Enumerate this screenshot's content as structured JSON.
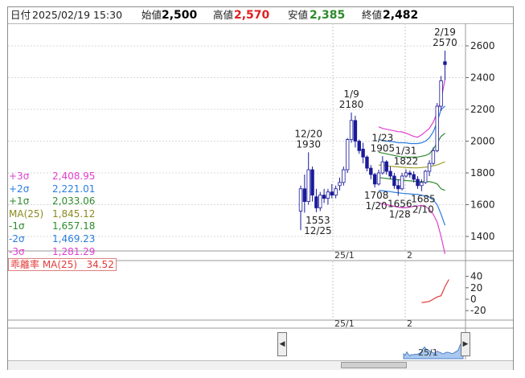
{
  "header": {
    "date_label": "日付",
    "datetime": "2025/02/19 15:30",
    "open_label": "始値",
    "open": "2,500",
    "high_label": "高値",
    "high": "2,570",
    "low_label": "安値",
    "low": "2,385",
    "close_label": "終値",
    "close": "2,482"
  },
  "legend": [
    {
      "name": "+3σ",
      "value": "2,408.95",
      "color": "#e040d0"
    },
    {
      "name": "+2σ",
      "value": "2,221.01",
      "color": "#2a7de0"
    },
    {
      "name": "+1σ",
      "value": "2,033.06",
      "color": "#2e8b2e"
    },
    {
      "name": "MA(25)",
      "value": "1,845.12",
      "color": "#8a8a20"
    },
    {
      "name": "-1σ",
      "value": "1,657.18",
      "color": "#2e8b2e"
    },
    {
      "name": "-2σ",
      "value": "1,469.23",
      "color": "#2a7de0"
    },
    {
      "name": "-3σ",
      "value": "1,281.29",
      "color": "#e040d0"
    }
  ],
  "oscillator": {
    "label": "乖離率 MA(25)",
    "value": "34.52",
    "color": "#e23a3a"
  },
  "x_tick_labels": [
    "25/1",
    "2"
  ],
  "navigator_tick_label": "25/1",
  "scroll_left_icon": "◀",
  "scroll_right_icon": "▶",
  "annotations": [
    {
      "date": "12/20",
      "value": "1930"
    },
    {
      "date": "1/9",
      "value": "2180"
    },
    {
      "date": "1/23",
      "value": "1905"
    },
    {
      "date": "1/31",
      "value": "1822"
    },
    {
      "date": "2/19",
      "value": "2570"
    },
    {
      "date": "12/25",
      "value": "1553"
    },
    {
      "date": "1/20",
      "value": "1708"
    },
    {
      "date": "1/28",
      "value": "1656"
    },
    {
      "date": "2/10",
      "value": "1685"
    }
  ],
  "chart_data": [
    {
      "type": "candlestick",
      "title": "",
      "y_ticks": [
        1400,
        1600,
        1800,
        2000,
        2200,
        2400,
        2600
      ],
      "ylim": [
        1290,
        2700
      ],
      "x_tick_labels": [
        "25/1",
        "2"
      ],
      "candles": [
        {
          "o": 1560,
          "h": 1720,
          "l": 1440,
          "c": 1700
        },
        {
          "o": 1700,
          "h": 1790,
          "l": 1550,
          "c": 1620
        },
        {
          "o": 1620,
          "h": 1930,
          "l": 1600,
          "c": 1820
        },
        {
          "o": 1820,
          "h": 1840,
          "l": 1620,
          "c": 1660
        },
        {
          "o": 1650,
          "h": 1700,
          "l": 1553,
          "c": 1580
        },
        {
          "o": 1580,
          "h": 1680,
          "l": 1560,
          "c": 1660
        },
        {
          "o": 1660,
          "h": 1700,
          "l": 1610,
          "c": 1640
        },
        {
          "o": 1640,
          "h": 1700,
          "l": 1600,
          "c": 1680
        },
        {
          "o": 1680,
          "h": 1730,
          "l": 1640,
          "c": 1660
        },
        {
          "o": 1660,
          "h": 1720,
          "l": 1640,
          "c": 1700
        },
        {
          "o": 1720,
          "h": 1770,
          "l": 1690,
          "c": 1740
        },
        {
          "o": 1740,
          "h": 1840,
          "l": 1720,
          "c": 1820
        },
        {
          "o": 1820,
          "h": 2020,
          "l": 1800,
          "c": 2010
        },
        {
          "o": 2010,
          "h": 2180,
          "l": 1990,
          "c": 2130
        },
        {
          "o": 2130,
          "h": 2160,
          "l": 1960,
          "c": 2000
        },
        {
          "o": 2000,
          "h": 2010,
          "l": 1920,
          "c": 1940
        },
        {
          "o": 1950,
          "h": 1990,
          "l": 1860,
          "c": 1900
        },
        {
          "o": 1900,
          "h": 1910,
          "l": 1810,
          "c": 1830
        },
        {
          "o": 1830,
          "h": 1850,
          "l": 1760,
          "c": 1790
        },
        {
          "o": 1790,
          "h": 1800,
          "l": 1708,
          "c": 1730
        },
        {
          "o": 1730,
          "h": 1820,
          "l": 1720,
          "c": 1800
        },
        {
          "o": 1800,
          "h": 1905,
          "l": 1790,
          "c": 1870
        },
        {
          "o": 1870,
          "h": 1880,
          "l": 1790,
          "c": 1810
        },
        {
          "o": 1810,
          "h": 1840,
          "l": 1760,
          "c": 1780
        },
        {
          "o": 1780,
          "h": 1800,
          "l": 1700,
          "c": 1720
        },
        {
          "o": 1720,
          "h": 1760,
          "l": 1656,
          "c": 1700
        },
        {
          "o": 1700,
          "h": 1800,
          "l": 1690,
          "c": 1780
        },
        {
          "o": 1780,
          "h": 1822,
          "l": 1770,
          "c": 1800
        },
        {
          "o": 1800,
          "h": 1815,
          "l": 1770,
          "c": 1790
        },
        {
          "o": 1790,
          "h": 1810,
          "l": 1740,
          "c": 1760
        },
        {
          "o": 1760,
          "h": 1780,
          "l": 1700,
          "c": 1720
        },
        {
          "o": 1720,
          "h": 1760,
          "l": 1685,
          "c": 1740
        },
        {
          "o": 1740,
          "h": 1820,
          "l": 1730,
          "c": 1810
        },
        {
          "o": 1810,
          "h": 1880,
          "l": 1780,
          "c": 1860
        },
        {
          "o": 1860,
          "h": 1960,
          "l": 1850,
          "c": 1940
        },
        {
          "o": 1940,
          "h": 2240,
          "l": 1930,
          "c": 2220
        },
        {
          "o": 2220,
          "h": 2410,
          "l": 2190,
          "c": 2380
        },
        {
          "o": 2500,
          "h": 2570,
          "l": 2385,
          "c": 2482
        }
      ],
      "bollinger": {
        "start_index": 20,
        "plus3": [
          2090,
          2080,
          2075,
          2070,
          2065,
          2060,
          2058,
          2050,
          2040,
          2030,
          2025,
          2040,
          2060,
          2080,
          2120,
          2180,
          2260,
          2390
        ],
        "plus2": [
          2010,
          2005,
          2000,
          1998,
          1995,
          1990,
          1990,
          1990,
          1985,
          1985,
          1985,
          1990,
          2000,
          2020,
          2060,
          2120,
          2200,
          2220
        ],
        "plus1": [
          1930,
          1925,
          1920,
          1915,
          1910,
          1905,
          1900,
          1900,
          1900,
          1900,
          1900,
          1905,
          1910,
          1920,
          1950,
          1990,
          2030,
          2050
        ],
        "ma": [
          1850,
          1848,
          1845,
          1842,
          1840,
          1838,
          1836,
          1834,
          1833,
          1832,
          1832,
          1834,
          1836,
          1840,
          1845,
          1850,
          1860,
          1870
        ],
        "minus1": [
          1770,
          1768,
          1765,
          1762,
          1760,
          1757,
          1755,
          1752,
          1750,
          1748,
          1745,
          1745,
          1745,
          1745,
          1740,
          1730,
          1700,
          1690
        ],
        "minus2": [
          1690,
          1688,
          1685,
          1682,
          1678,
          1675,
          1672,
          1670,
          1668,
          1666,
          1665,
          1660,
          1655,
          1648,
          1630,
          1600,
          1540,
          1470
        ],
        "minus3": [
          1610,
          1606,
          1600,
          1595,
          1590,
          1585,
          1580,
          1580,
          1585,
          1590,
          1592,
          1595,
          1590,
          1570,
          1540,
          1490,
          1400,
          1290
        ]
      }
    },
    {
      "type": "line",
      "title": "",
      "y_ticks": [
        40,
        20,
        0,
        -20
      ],
      "series": [
        {
          "name": "乖離率 MA(25)",
          "start_index": 31,
          "values": [
            -6,
            -5,
            -4,
            0,
            4,
            6,
            22,
            34.5
          ]
        }
      ]
    }
  ]
}
